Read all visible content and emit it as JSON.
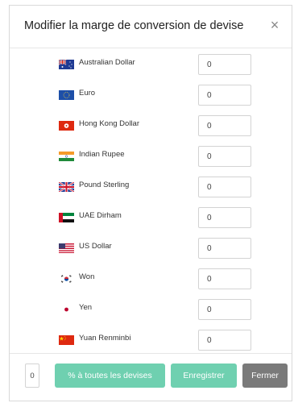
{
  "modal": {
    "title": "Modifier la marge de conversion de devise",
    "close_glyph": "×"
  },
  "currencies": [
    {
      "name": "Australian Dollar",
      "value": "0",
      "flag_icon": "flag-australia-icon"
    },
    {
      "name": "Euro",
      "value": "0",
      "flag_icon": "flag-eu-icon"
    },
    {
      "name": "Hong Kong Dollar",
      "value": "0",
      "flag_icon": "flag-hong-kong-icon"
    },
    {
      "name": "Indian Rupee",
      "value": "0",
      "flag_icon": "flag-india-icon"
    },
    {
      "name": "Pound Sterling",
      "value": "0",
      "flag_icon": "flag-uk-icon"
    },
    {
      "name": "UAE Dirham",
      "value": "0",
      "flag_icon": "flag-uae-icon"
    },
    {
      "name": "US Dollar",
      "value": "0",
      "flag_icon": "flag-usa-icon"
    },
    {
      "name": "Won",
      "value": "0",
      "flag_icon": "flag-south-korea-icon"
    },
    {
      "name": "Yen",
      "value": "0",
      "flag_icon": "flag-japan-icon"
    },
    {
      "name": "Yuan Renminbi",
      "value": "0",
      "flag_icon": "flag-china-icon"
    }
  ],
  "footer": {
    "global_margin_value": "0",
    "apply_all_label": "% à toutes les devises",
    "save_label": "Enregistrer",
    "close_label": "Fermer"
  },
  "colors": {
    "accent": "#6fd0b0",
    "secondary": "#7a7a7a"
  }
}
